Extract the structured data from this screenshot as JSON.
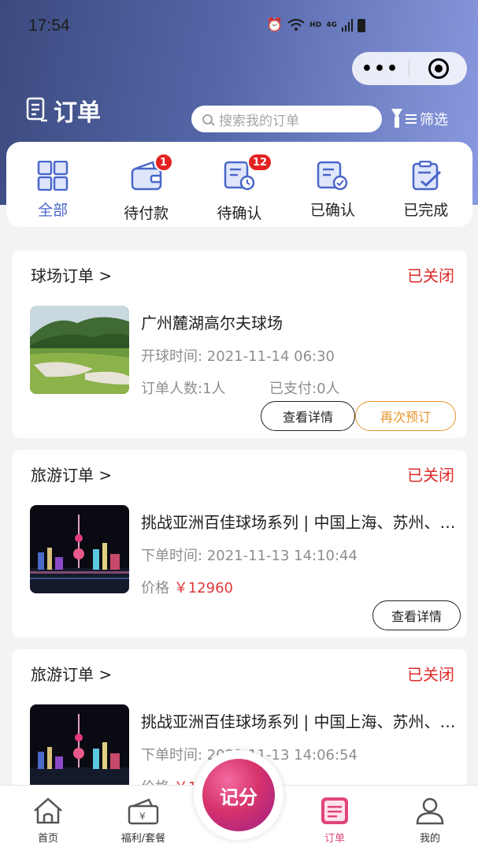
{
  "status_bar": {
    "time": "17:54",
    "network": "HD",
    "signal": "4G"
  },
  "page": {
    "title": "订单"
  },
  "search": {
    "placeholder": "搜索我的订单"
  },
  "filter": {
    "label": "筛选"
  },
  "tabs": [
    {
      "label": "全部",
      "badge": null,
      "active": true
    },
    {
      "label": "待付款",
      "badge": "1",
      "active": false
    },
    {
      "label": "待确认",
      "badge": "12",
      "active": false
    },
    {
      "label": "已确认",
      "badge": null,
      "active": false
    },
    {
      "label": "已完成",
      "badge": null,
      "active": false
    }
  ],
  "orders": [
    {
      "type": "球场订单 >",
      "status": "已关闭",
      "name": "广州麓湖高尔夫球场",
      "row1": "开球时间: 2021-11-14 06:30",
      "row2a": "订单人数:1人",
      "row2b": "已支付:0人",
      "btn_detail": "查看详情",
      "btn_rebook": "再次预订"
    },
    {
      "type": "旅游订单 >",
      "status": "已关闭",
      "name": "挑战亚洲百佳球场系列 | 中国上海、苏州、杭州",
      "row1": "下单时间: 2021-11-13 14:10:44",
      "price_label": "价格",
      "price": "￥12960",
      "btn_detail": "查看详情"
    },
    {
      "type": "旅游订单 >",
      "status": "已关闭",
      "name": "挑战亚洲百佳球场系列 | 中国上海、苏州、杭州",
      "row1": "下单时间: 2021-11-13 14:06:54",
      "price_label": "价格",
      "price": "￥1"
    }
  ],
  "tabbar": {
    "home": "首页",
    "welfare": "福利/套餐",
    "score": "记分",
    "orders": "订单",
    "mine": "我的"
  },
  "colors": {
    "accent": "#4a67c9",
    "closed": "#e02b2b",
    "price": "#de3a3a",
    "orange": "#e8952c",
    "active_tab": "#e0457c"
  }
}
